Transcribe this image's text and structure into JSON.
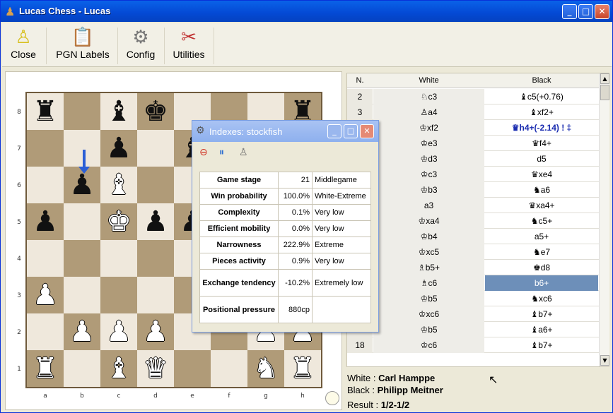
{
  "window": {
    "title": "Lucas Chess - Lucas",
    "min": "_",
    "max": "□",
    "close": "✕"
  },
  "toolbar": [
    {
      "label": "Close",
      "icon": "close-person-icon"
    },
    {
      "label": "PGN Labels",
      "icon": "pgn-labels-icon"
    },
    {
      "label": "Config",
      "icon": "config-gear-icon"
    },
    {
      "label": "Utilities",
      "icon": "utilities-tools-icon"
    }
  ],
  "board": {
    "ranks": [
      "8",
      "7",
      "6",
      "5",
      "4",
      "3",
      "2",
      "1"
    ],
    "files": [
      "a",
      "b",
      "c",
      "d",
      "e",
      "f",
      "g",
      "h"
    ]
  },
  "indexes": {
    "title": "Indexes: stockfish",
    "rows": [
      {
        "label": "Game stage",
        "value": "21",
        "desc": "Middlegame"
      },
      {
        "label": "Win probability",
        "value": "100.0%",
        "desc": "White-Extreme"
      },
      {
        "label": "Complexity",
        "value": "0.1%",
        "desc": "Very low"
      },
      {
        "label": "Efficient mobility",
        "value": "0.0%",
        "desc": "Very low"
      },
      {
        "label": "Narrowness",
        "value": "222.9%",
        "desc": "Extreme"
      },
      {
        "label": "Pieces activity",
        "value": "0.9%",
        "desc": "Very low"
      },
      {
        "label": "Exchange tendency",
        "value": "-10.2%",
        "desc": "Extremely low"
      },
      {
        "label": "Positional pressure",
        "value": "880cp",
        "desc": ""
      }
    ]
  },
  "pgn": {
    "headers": {
      "n": "N.",
      "white": "White",
      "black": "Black"
    },
    "rows": [
      {
        "n": "2",
        "w": "♘c3",
        "b": "♝c5(+0.76)"
      },
      {
        "n": "3",
        "w": "♙a4",
        "b": "♝xf2+"
      },
      {
        "n": "",
        "w": "♔xf2",
        "b": "♛h4+(-2.14) ! ‡"
      },
      {
        "n": "",
        "w": "♔e3",
        "b": "♛f4+"
      },
      {
        "n": "",
        "w": "♔d3",
        "b": "d5"
      },
      {
        "n": "",
        "w": "♔c3",
        "b": "♛xe4"
      },
      {
        "n": "",
        "w": "♔b3",
        "b": "♞a6"
      },
      {
        "n": "",
        "w": "a3",
        "b": "♛xa4+"
      },
      {
        "n": "",
        "w": "♔xa4",
        "b": "♞c5+"
      },
      {
        "n": "",
        "w": "♔b4",
        "b": "a5+"
      },
      {
        "n": "",
        "w": "♔xc5",
        "b": "♞e7"
      },
      {
        "n": "",
        "w": "♗b5+",
        "b": "♚d8"
      },
      {
        "n": "",
        "w": "♗c6",
        "b": "b6+"
      },
      {
        "n": "",
        "w": "♔b5",
        "b": "♞xc6"
      },
      {
        "n": "",
        "w": "♔xc6",
        "b": "♝b7+"
      },
      {
        "n": "",
        "w": "♔b5",
        "b": "♝a6+"
      },
      {
        "n": "18",
        "w": "♔c6",
        "b": "♝b7+"
      }
    ],
    "selected_row": 12
  },
  "game_info": {
    "white_label": "White : ",
    "white": "Carl Hamppe",
    "black_label": "Black : ",
    "black": "Philipp Meitner",
    "result_label": "Result : ",
    "result": "1/2-1/2"
  }
}
